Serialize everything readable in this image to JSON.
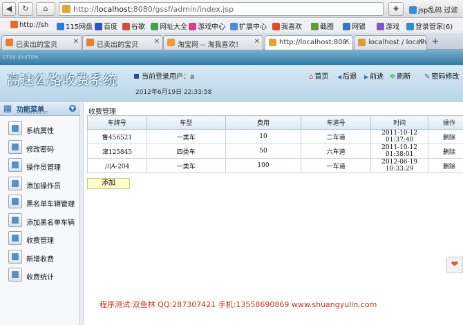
{
  "browser": {
    "url_prefix": "http://",
    "url_host": "localhost",
    "url_rest": ":8080/gssf/admin/index.jsp",
    "back_glyph": "◀",
    "refresh_glyph": "↻",
    "home_glyph": "⌂",
    "ext_label": "jsp乱码 过滤",
    "bookmarks": [
      {
        "label": "http://sh",
        "icon": "page-icon",
        "color": "#e36b2c"
      },
      {
        "label": "115网盘",
        "icon": "cloud-icon",
        "color": "#2d7bd6"
      },
      {
        "label": "百度",
        "icon": "baidu-icon",
        "color": "#2a55c8"
      },
      {
        "label": "谷歌",
        "icon": "google-icon",
        "color": "#d64a3a"
      },
      {
        "label": "网址大全",
        "icon": "globe-icon",
        "color": "#3fa34d"
      },
      {
        "label": "游戏中心",
        "icon": "game-icon",
        "color": "#d93f8a"
      },
      {
        "label": "扩展中心",
        "icon": "puzzle-icon",
        "color": "#4b8be0"
      },
      {
        "label": "我喜欢",
        "icon": "heart-icon",
        "color": "#e8452f"
      },
      {
        "label": "截图",
        "icon": "scissors-icon",
        "color": "#5b9b3a"
      },
      {
        "label": "网银",
        "icon": "bank-icon",
        "color": "#3b72c2"
      },
      {
        "label": "游戏",
        "icon": "game-icon",
        "color": "#7c58c9"
      },
      {
        "label": "登录管家(6)",
        "icon": "key-icon",
        "color": "#2f8fd2"
      }
    ],
    "tabs": [
      {
        "label": "已卖出的宝贝",
        "icon": "taobao-icon",
        "color": "#f07b2c"
      },
      {
        "label": "已卖出的宝贝",
        "icon": "taobao-icon",
        "color": "#f07b2c"
      },
      {
        "label": "淘宝网 -- 淘我喜欢！",
        "icon": "taobao-icon",
        "color": "#f59b2a"
      },
      {
        "label": "http://localhost:808...",
        "icon": "page-icon",
        "color": "#e6a33a"
      },
      {
        "label": "localhost / localho...",
        "icon": "db-icon",
        "color": "#e09a36"
      }
    ],
    "new_tab": "+"
  },
  "header": {
    "subtitle": "CFSS SYSTEM",
    "title": "高速公路收费系统",
    "current_user_label": "当前登录用户：a",
    "datetime": "2012年6月19日  22:33:58",
    "nav": [
      {
        "label": "首页",
        "icon": "home-icon",
        "glyph": "⌂"
      },
      {
        "label": "后退",
        "icon": "back-icon",
        "glyph": "◀"
      },
      {
        "label": "前进",
        "icon": "forward-icon",
        "glyph": "▶"
      },
      {
        "label": "刷新",
        "icon": "refresh-icon",
        "glyph": "✲"
      },
      {
        "label": "密码修改",
        "icon": "lock-icon",
        "glyph": "✎"
      }
    ]
  },
  "sidebar": {
    "title": "功能菜单",
    "subtitle": "MANAGEMENT",
    "items": [
      {
        "label": "系统属性"
      },
      {
        "label": "修改密码"
      },
      {
        "label": "操作员管理"
      },
      {
        "label": "添加操作员"
      },
      {
        "label": "黑名单车辆管理"
      },
      {
        "label": "添加黑名单车辆"
      },
      {
        "label": "收费管理"
      },
      {
        "label": "新增收费"
      },
      {
        "label": "收费统计"
      }
    ]
  },
  "main": {
    "panel_title": "收费管理",
    "columns": [
      "车牌号",
      "车型",
      "费用",
      "车道号",
      "时间",
      "操作"
    ],
    "rows": [
      [
        "鲁456521",
        "一类车",
        "10",
        "二车道",
        "2011-10-12 01:37:40",
        "删除"
      ],
      [
        "津125845",
        "四类车",
        "50",
        "六车道",
        "2011-10-12 01:38:01",
        "删除"
      ],
      [
        "川A-204",
        "一类车",
        "100",
        "一车道",
        "2012-06-19 10:33:29",
        "删除"
      ]
    ],
    "add_label": "添加"
  },
  "footer": {
    "text": "程序测试:双鱼林 QQ:287307421 手机:13558690869 www.shuangyulin.com"
  }
}
